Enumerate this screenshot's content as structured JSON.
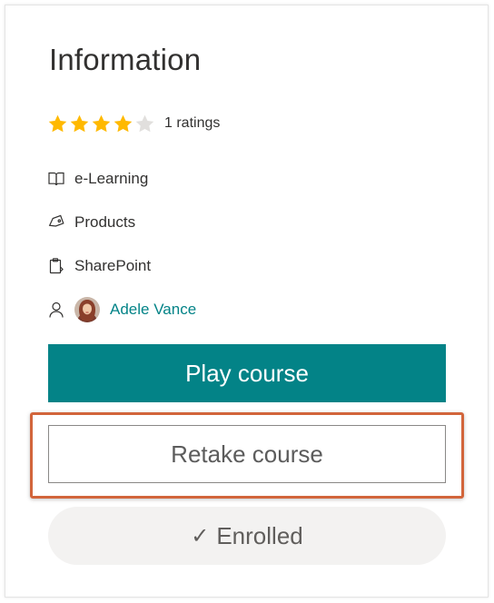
{
  "info": {
    "title": "Information",
    "rating": {
      "value": 4,
      "max": 5,
      "count_label": "1 ratings",
      "filled_color": "#ffb900",
      "empty_color": "#e1dfdd"
    },
    "meta": {
      "format": {
        "icon": "book-icon",
        "label": "e-Learning"
      },
      "category": {
        "icon": "tag-icon",
        "label": "Products"
      },
      "product": {
        "icon": "clipboard-icon",
        "label": "SharePoint"
      },
      "author": {
        "icon": "person-icon",
        "name": "Adele Vance"
      }
    }
  },
  "actions": {
    "play_label": "Play course",
    "retake_label": "Retake course",
    "enrolled_label": "Enrolled",
    "enrolled_icon": "checkmark-icon"
  },
  "colors": {
    "accent": "#038387",
    "highlight": "#d2653b"
  }
}
